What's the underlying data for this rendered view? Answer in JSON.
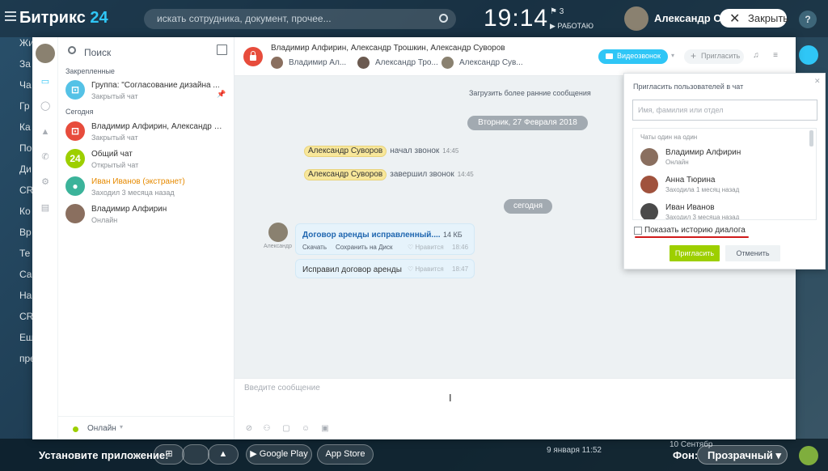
{
  "portal": {
    "logo_text": "Битрикс",
    "logo_num": "24",
    "search_placeholder": "искать сотрудника, документ, прочее...",
    "clock": "19:14",
    "flags": "3",
    "work_status": "РАБОТАЮ",
    "user_name": "Александр Суворов",
    "close_label": "Закрыть",
    "help": "?",
    "left_menu": [
      "Жи",
      "За",
      "Ча",
      "Гр",
      "Ка",
      "По",
      "Ди",
      "CR",
      "Ко",
      "Вр",
      "Те",
      "Са",
      "На",
      "CR",
      "Еш",
      "пре"
    ],
    "install_label": "Установите приложение:",
    "google_play": "Google Play",
    "app_store": "App Store",
    "fon_label": "Фон:",
    "fon_value": "Прозрачный",
    "bottom_date": "9 января 11:52",
    "bottom_sept": "10 Сентябр"
  },
  "sidebar": {
    "search_label": "Поиск",
    "pinned_title": "Закрепленные",
    "today_title": "Сегодня",
    "pinned": [
      {
        "name": "Группа: \"Согласование дизайна ...",
        "sub": "Закрытый чат",
        "color": "#55c2e6"
      }
    ],
    "today": [
      {
        "name": "Владимир Алфирин, Александр Тр...",
        "sub": "Закрытый чат",
        "color": "#e74c3c",
        "avatar_text": ""
      },
      {
        "name": "Общий чат",
        "sub": "Открытый чат",
        "color": "#9dcf00",
        "avatar_text": "24"
      },
      {
        "name": "Иван Иванов (экстранет)",
        "sub": "Заходил 3 месяца назад",
        "color": "#3bb39a",
        "avatar_text": ""
      },
      {
        "name": "Владимир Алфирин",
        "sub": "Онлайн",
        "color": "#8a6f5f",
        "avatar_text": ""
      }
    ],
    "status_label": "Онлайн"
  },
  "dialog": {
    "title": "Владимир Алфирин, Александр Трошкин, Александр Суворов",
    "members": [
      "Владимир Ал...",
      "Александр Тро...",
      "Александр Сув..."
    ],
    "video_label": "Видеозвонок",
    "invite_label": "Пригласить",
    "load_more": "Загрузить более ранние сообщения",
    "date1": "Вторник, 27 Февраля 2018",
    "date2": "сегодня",
    "sys1": {
      "who": "Александр Суворов",
      "what": "начал звонок",
      "time": "14:45"
    },
    "sys2": {
      "who": "Александр Суворов",
      "what": "завершил звонок",
      "time": "14:45"
    },
    "author_short": "Александр",
    "file_name": "Договор аренды исправленный....",
    "file_size": "14 КБ",
    "download": "Скачать",
    "save_disk": "Сохранить на Диск",
    "like": "Нравится",
    "time1": "18:46",
    "msg2": "Исправил договор аренды",
    "time2": "18:47",
    "input_placeholder": "Введите сообщение"
  },
  "popup": {
    "title": "Пригласить пользователей в чат",
    "input_placeholder": "Имя, фамилия или отдел",
    "list_title": "Чаты один на один",
    "people": [
      {
        "name": "Владимир Алфирин",
        "status": "Онлайн",
        "color": "#8a6f5f"
      },
      {
        "name": "Анна Тюрина",
        "status": "Заходила 1 месяц назад",
        "color": "#a0523d"
      },
      {
        "name": "Иван Иванов",
        "status": "Заходил 3 месяца назад",
        "color": "#4a4a4a"
      }
    ],
    "checkbox_label": "Показать историю диалога",
    "ok_label": "Пригласить",
    "cancel_label": "Отменить"
  }
}
